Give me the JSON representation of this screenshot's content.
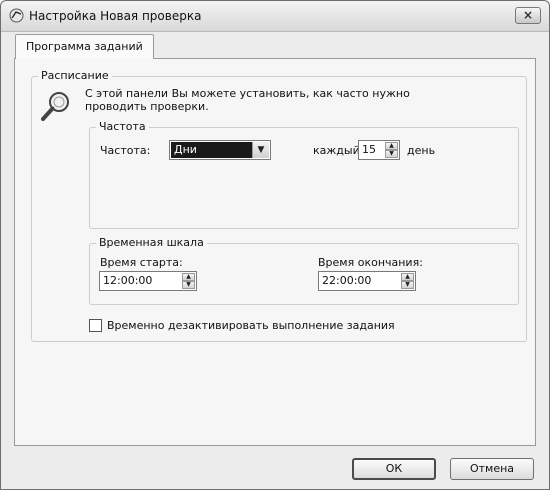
{
  "window": {
    "title": "Настройка Новая проверка",
    "close_label": "×"
  },
  "tabs": [
    {
      "label": "Программа заданий"
    }
  ],
  "schedule": {
    "legend": "Расписание",
    "description": "С этой панели Вы можете установить, как часто нужно проводить проверки."
  },
  "frequency": {
    "legend": "Частота",
    "label": "Частота:",
    "selected": "Дни",
    "every_label": "каждый",
    "every_value": "15",
    "unit_label": "день"
  },
  "timeline": {
    "legend": "Временная шкала",
    "start_label": "Время старта:",
    "start_value": "12:00:00",
    "end_label": "Время окончания:",
    "end_value": "22:00:00"
  },
  "disable_checkbox": {
    "label": "Временно дезактивировать выполнение задания",
    "checked": false
  },
  "buttons": {
    "ok": "ОК",
    "cancel": "Отмена"
  },
  "icons": [
    "app-icon",
    "magnifier-icon",
    "close-icon",
    "chevron-down-icon",
    "spin-up-icon",
    "spin-down-icon"
  ]
}
